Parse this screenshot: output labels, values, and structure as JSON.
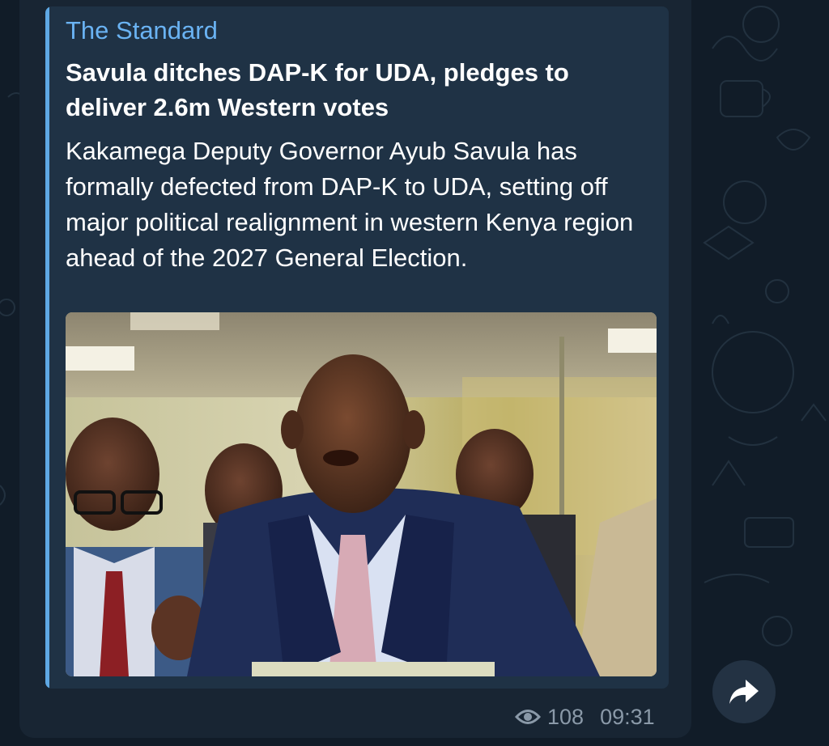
{
  "message": {
    "link_preview": {
      "site_name": "The Standard",
      "headline": "Savula ditches DAP-K for UDA, pledges to deliver 2.6m Western votes",
      "description": "Kakamega Deputy Governor Ayub Savula has formally defected from DAP-K to UDA, setting off major political realignment in western Kenya region ahead of the 2027 General Election.",
      "image_alt": "Photo of Ayub Savula speaking at a press briefing"
    },
    "views": "108",
    "time": "09:31",
    "icons": {
      "views": "eye-icon",
      "forward": "forward-arrow-icon"
    }
  },
  "colors": {
    "background": "#111c28",
    "bubble": "#182533",
    "preview": "#1f3245",
    "accent_bar": "#5ea8e4",
    "site_name": "#6ab3f3",
    "meta_text": "#8a99a8"
  }
}
